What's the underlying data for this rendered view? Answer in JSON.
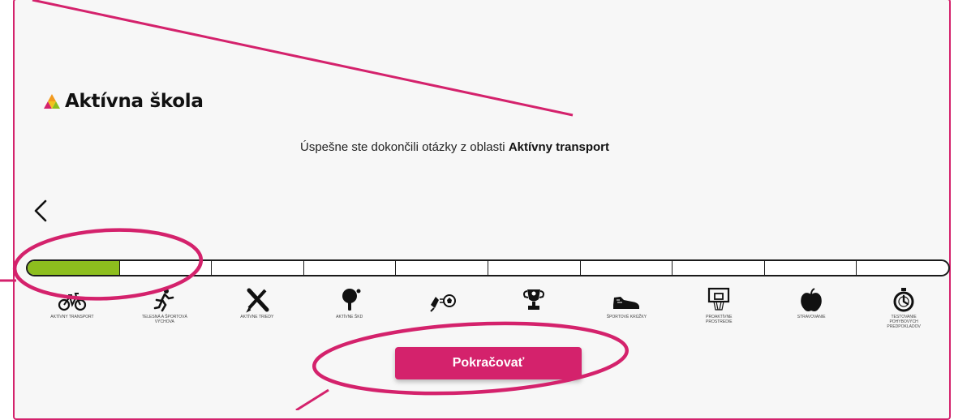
{
  "app": {
    "logo_text": "Aktívna škola"
  },
  "message": {
    "prefix": "Úspešne ste dokončili otázky z oblasti",
    "topic": "Aktívny transport"
  },
  "progress": {
    "total_segments": 10,
    "completed_segments": 1,
    "fill_color": "#8dbe1e"
  },
  "categories": [
    {
      "label": "AKTÍVNY TRANSPORT",
      "icon": "bicycle-icon"
    },
    {
      "label": "TELESNÁ A ŠPORTOVÁ VÝCHOVA",
      "icon": "runner-icon"
    },
    {
      "label": "AKTÍVNE TRIEDY",
      "icon": "ruler-pencil-icon"
    },
    {
      "label": "AKTÍVNE ŠKD",
      "icon": "table-tennis-icon"
    },
    {
      "label": "",
      "icon": "soccer-icon"
    },
    {
      "label": "",
      "icon": "trophy-icon"
    },
    {
      "label": "ŠPORTOVÉ KRÚŽKY",
      "icon": "sneaker-icon"
    },
    {
      "label": "PROAKTÍVNE PROSTREDIE",
      "icon": "basketball-hoop-icon"
    },
    {
      "label": "STRAVOVANIE",
      "icon": "apple-icon"
    },
    {
      "label": "TESTOVANIE POHYBOVÝCH PREDPOKLADOV",
      "icon": "stopwatch-icon"
    }
  ],
  "button": {
    "continue_label": "Pokračovať"
  },
  "colors": {
    "accent": "#d4226c",
    "progress_fill": "#8dbe1e"
  }
}
